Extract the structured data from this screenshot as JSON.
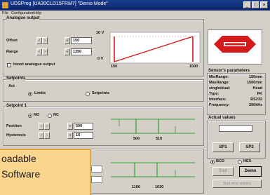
{
  "window": {
    "title": "UDSProg  [UA30CLD15FRM7] \"Demo Mode\"",
    "min_label": "_",
    "max_label": "□",
    "close_label": "×"
  },
  "menu": {
    "file": "File",
    "configuration": "Configuration",
    "help": "Help"
  },
  "analogue_output": {
    "title": "Analogue output",
    "offset_label": "Offset",
    "offset_value": "150",
    "range_label": "Range",
    "range_value": "1350",
    "invert_label": "Invert analogue output"
  },
  "graph_top": {
    "y_high": "10 V",
    "y_low": "0 V",
    "x_low": "150",
    "x_high": "1500"
  },
  "setpoints": {
    "title": "Setpoints",
    "act_label": "Act",
    "limits_label": "Limits",
    "setpoints_label": "Setpoints"
  },
  "setpoint1": {
    "title": "Setpoint 1",
    "no_label": "NO",
    "nc_label": "NC",
    "position_label": "Position",
    "position_value": "500",
    "hysteresis_label": "Hysteresis",
    "hysteresis_value": "10",
    "graph_x1": "500",
    "graph_x2": "510"
  },
  "setpoint2": {
    "graph_x1": "1100",
    "graph_x2": "1020"
  },
  "sensor_params": {
    "title": "Sensor's parameters",
    "rows": [
      {
        "label": "MinRange:",
        "value": "150mm"
      },
      {
        "label": "MaxRange:",
        "value": "1500mm"
      },
      {
        "label": "single/dual:",
        "value": "Head"
      },
      {
        "label": "Type:",
        "value": "FK"
      },
      {
        "label": "Interface:",
        "value": "RS232"
      },
      {
        "label": "Frequency:",
        "value": "200kHz"
      }
    ]
  },
  "actual_values": {
    "title": "Actual values",
    "sp1_label": "SP1",
    "sp2_label": "SP2",
    "bcd_label": "BCD",
    "hex_label": "HEX",
    "start_label": "Start",
    "demo_label": "Demo",
    "start_errors_label": "Start error statistic"
  },
  "overlay": {
    "line1": "oadable",
    "line2": "Software"
  },
  "colors": {
    "title_bar": "#0a246a",
    "logo_red": "#d41a1a",
    "graph_red": "#d01515",
    "graph_green": "#2ea02e",
    "overlay_bg": "#f9d58e"
  }
}
